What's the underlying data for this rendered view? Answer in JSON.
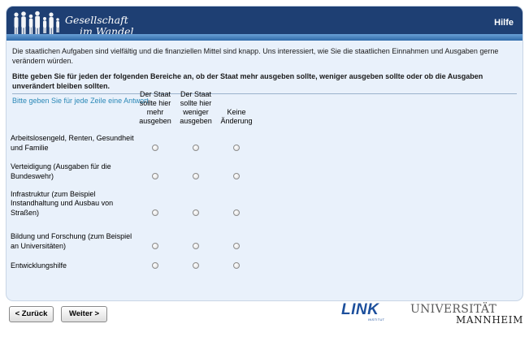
{
  "header": {
    "logo_line1": "Gesellschaft",
    "logo_line2": "im Wandel",
    "help_label": "Hilfe"
  },
  "intro": "Die staatlichen Aufgaben sind vielfältig und die finanziellen Mittel sind knapp. Uns interessiert, wie Sie die staatlichen Einnahmen und Ausgaben gerne verändern würden.",
  "question": "Bitte geben Sie für jeden der folgenden Bereiche an, ob der Staat mehr ausgeben sollte, weniger ausgeben sollte oder ob die Ausgaben unverändert bleiben sollten.",
  "instruction": "Bitte geben Sie für jede Zeile eine Antwort.",
  "columns": [
    "Der Staat sollte hier mehr ausgeben",
    "Der Staat sollte hier weniger ausgeben",
    "Keine Änderung"
  ],
  "rows": [
    "Arbeitslosengeld, Renten, Gesundheit und Familie",
    "Verteidigung (Ausgaben für die Bundeswehr)",
    "Infrastruktur (zum Beispiel Instandhaltung und Ausbau von Straßen)",
    "Bildung und Forschung (zum Beispiel an Universitäten)",
    "Entwicklungshilfe"
  ],
  "nav": {
    "back_label": "< Zurück",
    "next_label": "Weiter >"
  },
  "footer": {
    "link_logo": "LINK",
    "link_sub": "INSTITUT",
    "uni_line1": "UNIVERSITÄT",
    "uni_line2": "MANNHEIM"
  },
  "colors": {
    "header_bg": "#1e3f73",
    "panel_bg": "#e9f1fb",
    "instruction_text": "#2a88b7",
    "link_blue": "#1c4f9c"
  },
  "icons": {
    "logo": "people-silhouettes-icon",
    "radio": "radio-button-icon"
  }
}
